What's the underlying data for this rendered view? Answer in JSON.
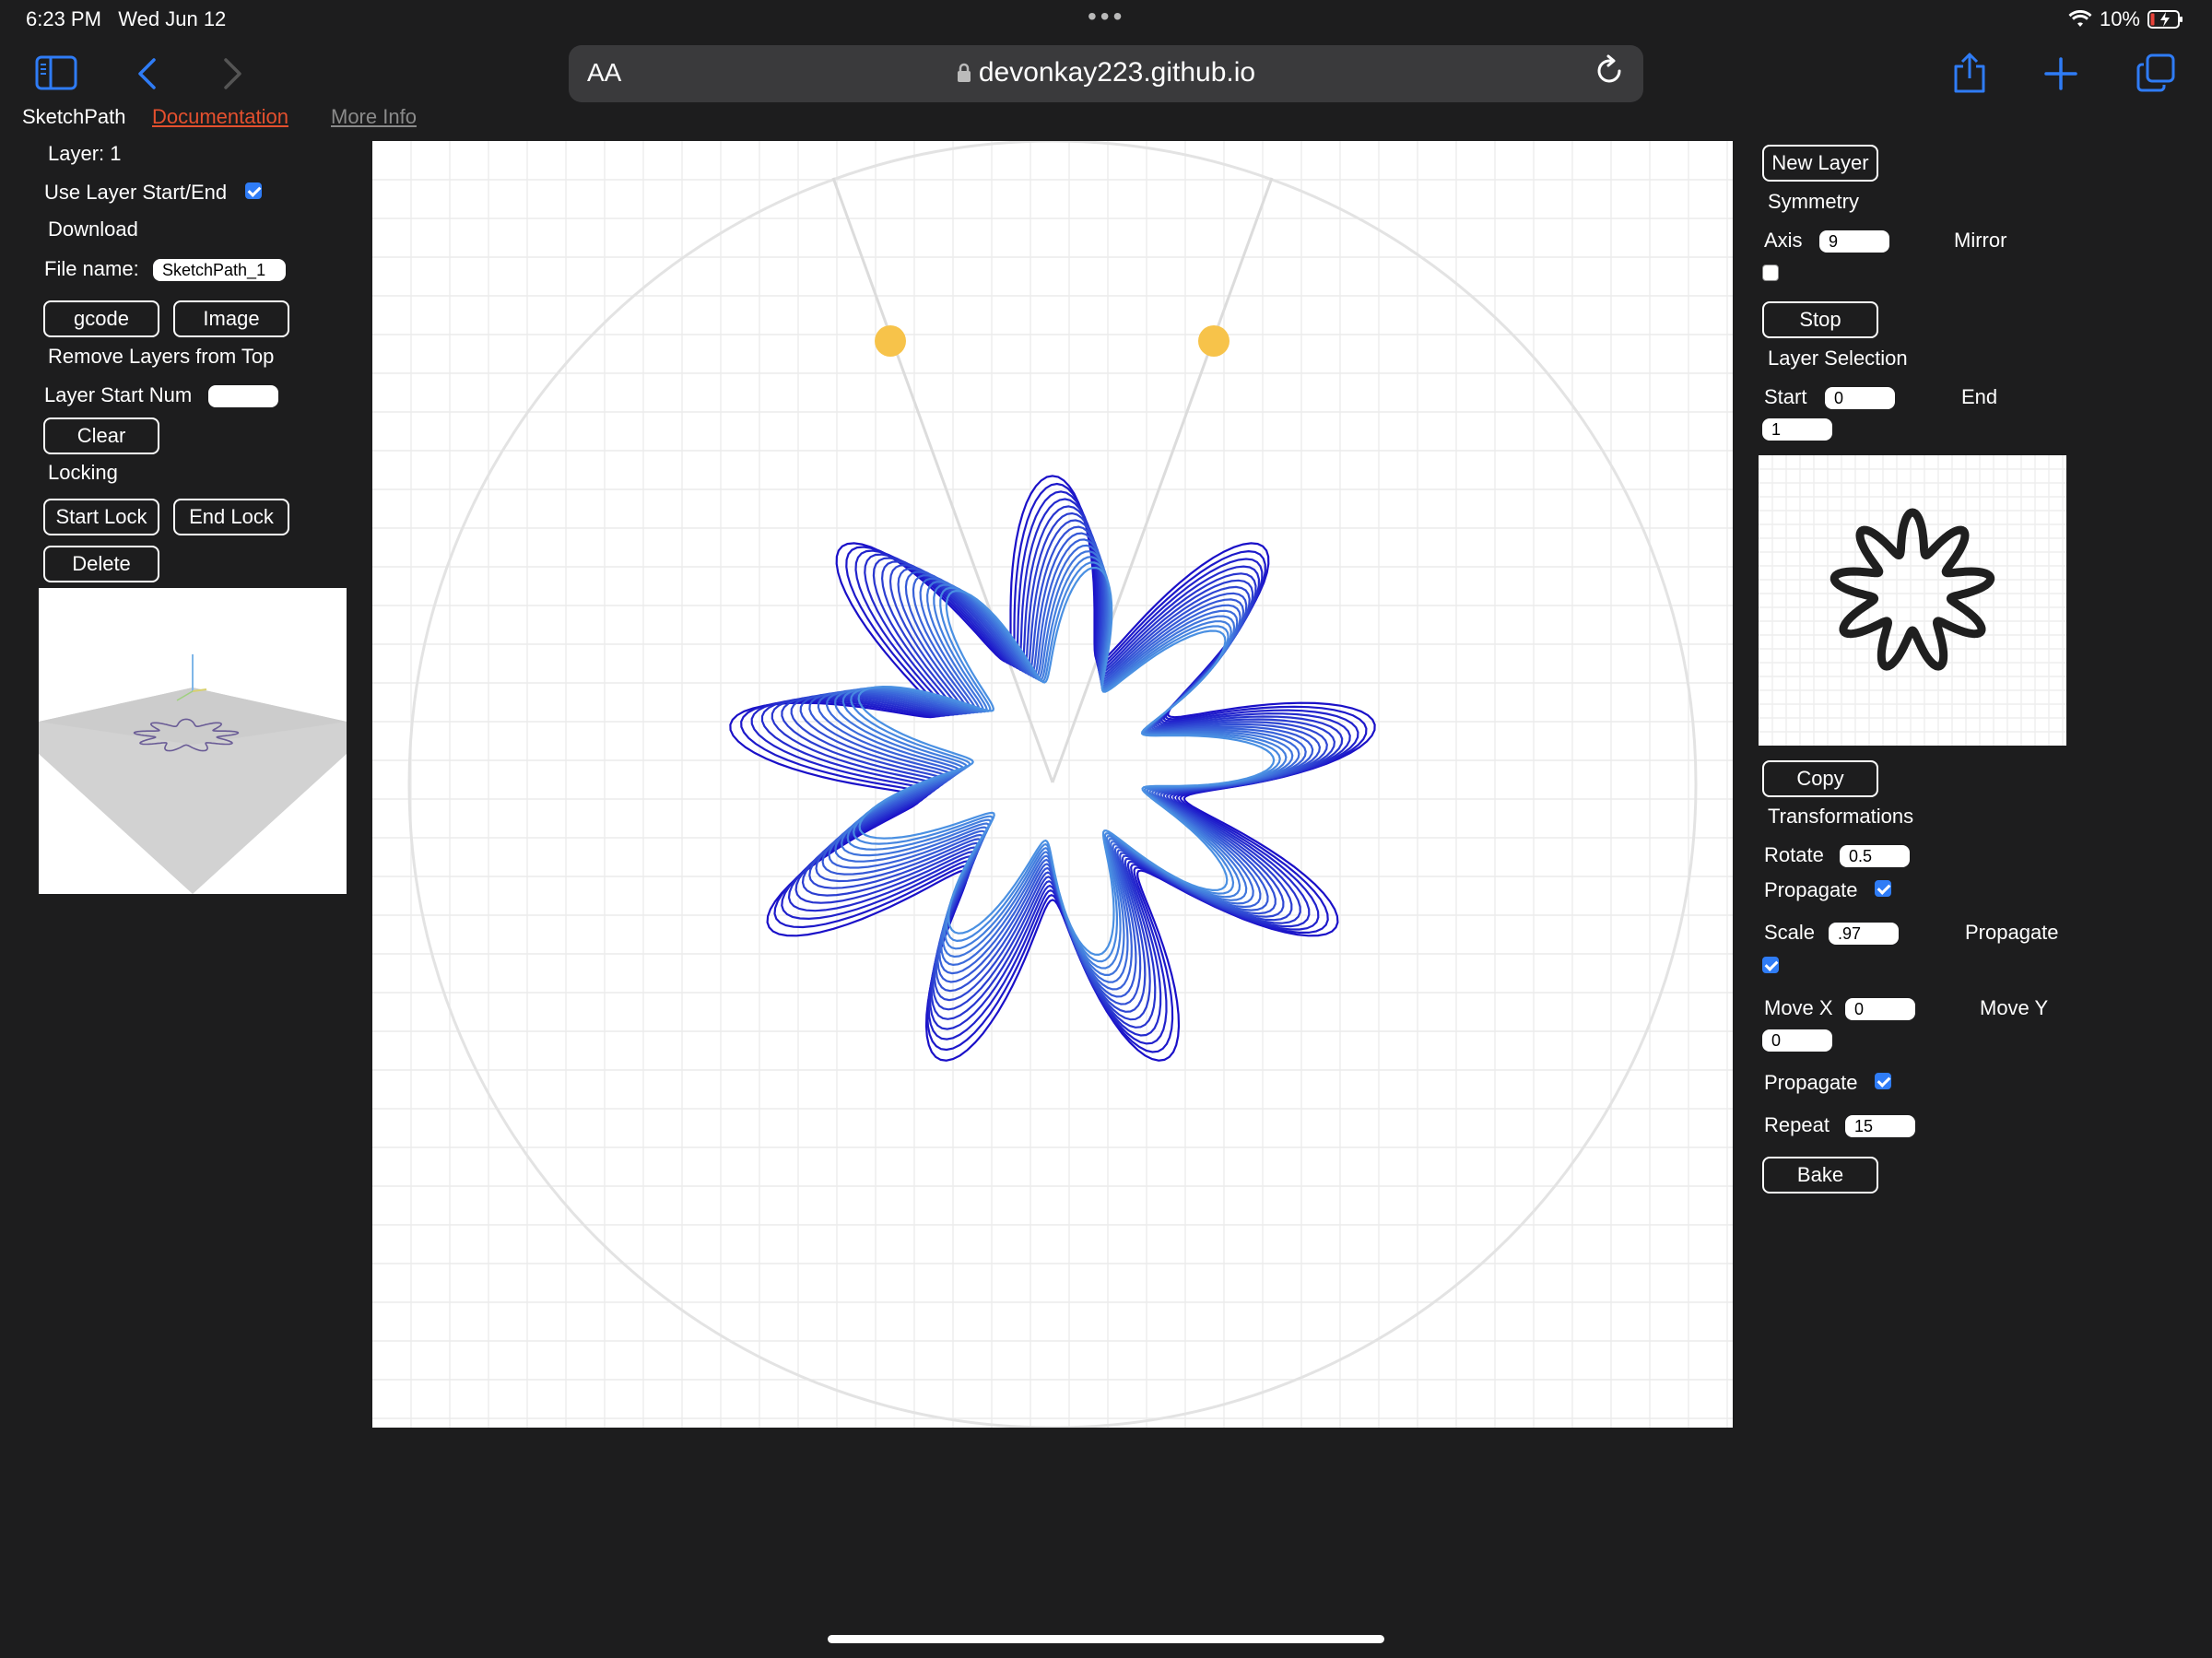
{
  "status_bar": {
    "time": "6:23 PM",
    "date": "Wed Jun 12",
    "battery": "10%"
  },
  "browser": {
    "aa_label": "AA",
    "url": "devonkay223.github.io",
    "icons": [
      "sidebar-icon",
      "back-icon",
      "forward-icon",
      "share-icon",
      "new-tab-icon",
      "tabs-icon",
      "reload-icon",
      "lock-icon"
    ]
  },
  "header_links": {
    "app": "SketchPath",
    "documentation": "Documentation",
    "more_info": "More Info"
  },
  "left_panel": {
    "layer_label": "Layer: 1",
    "use_layer_start_end": "Use Layer Start/End",
    "use_layer_start_end_checked": true,
    "download_label": "Download",
    "file_name_label": "File name:",
    "file_name_value": "SketchPath_1",
    "gcode_button": "gcode",
    "image_button": "Image",
    "remove_layers_label": "Remove Layers from Top",
    "layer_start_num_label": "Layer Start Num",
    "layer_start_num_value": "",
    "clear_button": "Clear",
    "locking_label": "Locking",
    "start_lock_button": "Start Lock",
    "end_lock_button": "End Lock",
    "delete_button": "Delete"
  },
  "right_panel": {
    "new_layer_button": "New Layer",
    "symmetry_label": "Symmetry",
    "axis_label": "Axis",
    "axis_value": "9",
    "mirror_label": "Mirror",
    "mirror_checked": false,
    "stop_button": "Stop",
    "layer_selection_label": "Layer Selection",
    "start_label": "Start",
    "start_value": "0",
    "end_label": "End",
    "end_value": "1",
    "copy_button": "Copy",
    "transformations_label": "Transformations",
    "rotate_label": "Rotate",
    "rotate_value": "0.5",
    "propagate_label": "Propagate",
    "rotate_propagate_checked": true,
    "scale_label": "Scale",
    "scale_value": ".97",
    "scale_propagate_checked": true,
    "move_x_label": "Move X",
    "move_x_value": "0",
    "move_y_label": "Move Y",
    "move_y_value": "0",
    "move_propagate_checked": true,
    "repeat_label": "Repeat",
    "repeat_value": "15",
    "bake_button": "Bake"
  },
  "canvas": {
    "petals": 9,
    "repeat": 15,
    "scale": 0.97,
    "handle_color": "#f7c34a",
    "stroke_color_start": "#1a10c8",
    "stroke_color_end": "#4a90e2"
  }
}
